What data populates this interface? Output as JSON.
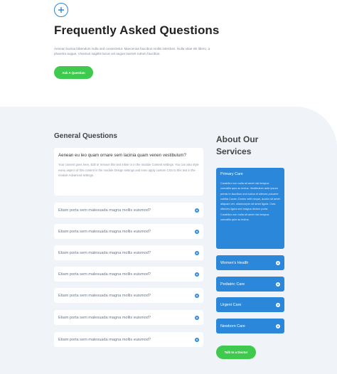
{
  "header": {
    "logo_icon": "plus-circle-icon",
    "title": "Frequently Asked Questions",
    "intro": "Aenean lacinia bibendum nulla sed consectetur. Maecenas faucibus mollis interdum. Nulla vitae elit libero, a pharetra augue. Vivamus sagittis lacus vel augue laoreet rutrum faucibus.",
    "ask_button": "Ask A Question"
  },
  "faq": {
    "section_title": "General Questions",
    "open_item": {
      "question": "Aenean eu leo quam ornare sem lacinia quam venen vestibulum?",
      "answer": "Your content goes here. Edit or remove this text inline or in the module Content settings. You can also style every aspect of this content in the module Design settings and even apply custom CSS to this text in the module Advanced settings."
    },
    "items": [
      {
        "question": "Etiam porta sem malesuada magna mollis euismod?"
      },
      {
        "question": "Etiam porta sem malesuada magna mollis euismod?"
      },
      {
        "question": "Etiam porta sem malesuada magna mollis euismod?"
      },
      {
        "question": "Etiam porta sem malesuada magna mollis euismod?"
      },
      {
        "question": "Etiam porta sem malesuada magna mollis euismod?"
      },
      {
        "question": "Etiam porta sem malesuada magna mollis euismod?"
      },
      {
        "question": "Etiam porta sem malesuada magna mollis euismod?"
      }
    ]
  },
  "services": {
    "section_title": "About Our Services",
    "open_item": {
      "title": "Primary Care",
      "description": "Curabitur non nulla sit amet nisl tempus convallis quis ac lectus. Vestibulum ante ipsum primis in faucibus orci luctus et ultrices posuere cubilia Curae; Donec velit neque, auctor sit amet aliquam vel, ullamcorper sit amet ligula. Cras ultricies ligula sed magna dictum porta. Curabitur non nulla sit amet nisl tempus convallis quis ac lectus."
    },
    "items": [
      {
        "title": "Women's Health"
      },
      {
        "title": "Pediatric Care"
      },
      {
        "title": "Urgent Care"
      },
      {
        "title": "Newborn Care"
      }
    ],
    "talk_button": "Talk to a Doctor"
  },
  "colors": {
    "accent_blue": "#2b87da",
    "button_green": "#3fc94e",
    "section_bg": "#f0f3f8"
  }
}
